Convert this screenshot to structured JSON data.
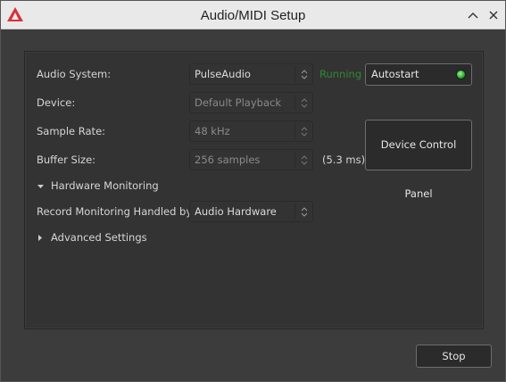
{
  "window": {
    "title": "Audio/MIDI Setup",
    "icons": {
      "app": "app-logo-icon",
      "minimize": "chevron-up-icon",
      "close": "close-icon"
    }
  },
  "audio_system": {
    "label": "Audio System:",
    "value": "PulseAudio"
  },
  "status": {
    "running": "Running",
    "running_color": "#2f8a2f"
  },
  "autostart": {
    "label": "Autostart",
    "led_color": "#2fa82f"
  },
  "device": {
    "label": "Device:",
    "value": "Default Playback"
  },
  "sample_rate": {
    "label": "Sample Rate:",
    "value": "48 kHz"
  },
  "buffer_size": {
    "label": "Buffer Size:",
    "value": "256 samples",
    "latency": "(5.3 ms)"
  },
  "device_control_panel": {
    "label": "Device Control Panel"
  },
  "hardware_monitoring": {
    "label": "Hardware Monitoring",
    "expanded": true
  },
  "record_monitoring": {
    "label": "Record Monitoring Handled by:",
    "value": "Audio Hardware"
  },
  "advanced_settings": {
    "label": "Advanced Settings",
    "expanded": false
  },
  "footer": {
    "stop_label": "Stop"
  }
}
